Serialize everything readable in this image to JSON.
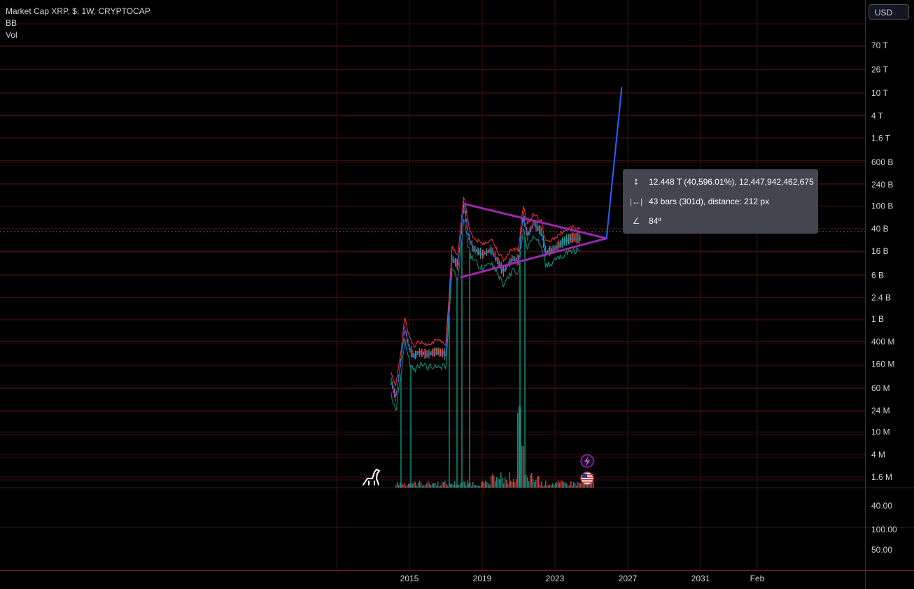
{
  "header": {
    "symbol_line": "Market Cap XRP, $, 1W, CRYPTOCAP",
    "indicator_bb": "BB",
    "indicator_vol": "Vol"
  },
  "toolbar": {
    "currency_label": "USD"
  },
  "measure_tooltip": {
    "price_change": "12.448 T (40,596.01%), 12,447,942,462,675",
    "range": "43 bars (301d), distance: 212 px",
    "angle": "84º"
  },
  "icons": {
    "measure_price": "vertical-arrows-icon",
    "measure_range": "horizontal-range-icon",
    "measure_angle": "angle-icon",
    "lightning": "lightning-icon",
    "flag": "us-flag-icon",
    "logo": "dino-icon"
  },
  "colors": {
    "background": "#000000",
    "grid": "#3a0f0f",
    "up": "#26a69a",
    "down": "#ef5350",
    "bb_upper": "#f23645",
    "bb_lower": "#089981",
    "bb_basis": "#2962ff",
    "triangle": "#9c27b0",
    "projection": "#2962ff"
  },
  "chart_data": {
    "type": "line",
    "scale": "log",
    "price_axis_labels": [
      "70 T",
      "26 T",
      "10 T",
      "4 T",
      "1.6 T",
      "600 B",
      "240 B",
      "100 B",
      "40 B",
      "16 B",
      "6 B",
      "2.4 B",
      "1 B",
      "400 M",
      "160 M",
      "60 M",
      "24 M",
      "10 M",
      "4 M",
      "1.6 M"
    ],
    "price_axis_values": [
      70000000000000.0,
      26000000000000.0,
      10000000000000.0,
      4000000000000.0,
      1600000000000.0,
      600000000000.0,
      240000000000.0,
      100000000000.0,
      40000000000.0,
      16000000000.0,
      6000000000.0,
      2400000000.0,
      1000000000.0,
      400000000.0,
      160000000.0,
      60000000.0,
      24000000.0,
      10000000.0,
      4000000.0,
      1600000.0
    ],
    "lower_pane_labels": [
      "40.00",
      "100.00",
      "50.00"
    ],
    "time_axis_labels": [
      "2015",
      "2019",
      "2023",
      "2027",
      "2031",
      "Feb"
    ],
    "series": [
      {
        "kind": "price",
        "x": [
          "2014-01",
          "2014-04",
          "2014-07",
          "2014-10",
          "2015-01",
          "2015-04",
          "2015-07",
          "2016-01",
          "2016-07",
          "2017-01",
          "2017-03",
          "2017-05",
          "2017-09",
          "2018-01",
          "2018-04",
          "2018-07",
          "2019-01",
          "2019-07",
          "2020-03",
          "2020-09",
          "2021-01",
          "2021-04",
          "2021-07",
          "2021-11",
          "2022-04",
          "2022-07",
          "2023-01",
          "2023-07",
          "2024-01",
          "2024-06"
        ],
        "values": [
          80000000.0,
          40000000.0,
          150000000.0,
          700000000.0,
          300000000.0,
          220000000.0,
          260000000.0,
          240000000.0,
          270000000.0,
          240000000.0,
          1500000000.0,
          12000000000.0,
          9000000000.0,
          110000000000.0,
          30000000000.0,
          18000000000.0,
          14000000000.0,
          17000000000.0,
          7000000000.0,
          12000000000.0,
          11000000000.0,
          70000000000.0,
          30000000000.0,
          50000000000.0,
          35000000000.0,
          15000000000.0,
          18000000000.0,
          24000000000.0,
          28000000000.0,
          27000000000.0
        ]
      }
    ],
    "annotations": [
      {
        "type": "trendline",
        "from": [
          "2018-01",
          110000000000.0
        ],
        "to": [
          "2025-11",
          27000000000.0
        ]
      },
      {
        "type": "trendline",
        "from": [
          "2017-11",
          5500000000.0
        ],
        "to": [
          "2025-11",
          27000000000.0
        ]
      },
      {
        "type": "trendline",
        "from": [
          "2025-11",
          27000000000.0
        ],
        "to": [
          "2026-09",
          12500000000000.0
        ]
      }
    ]
  }
}
